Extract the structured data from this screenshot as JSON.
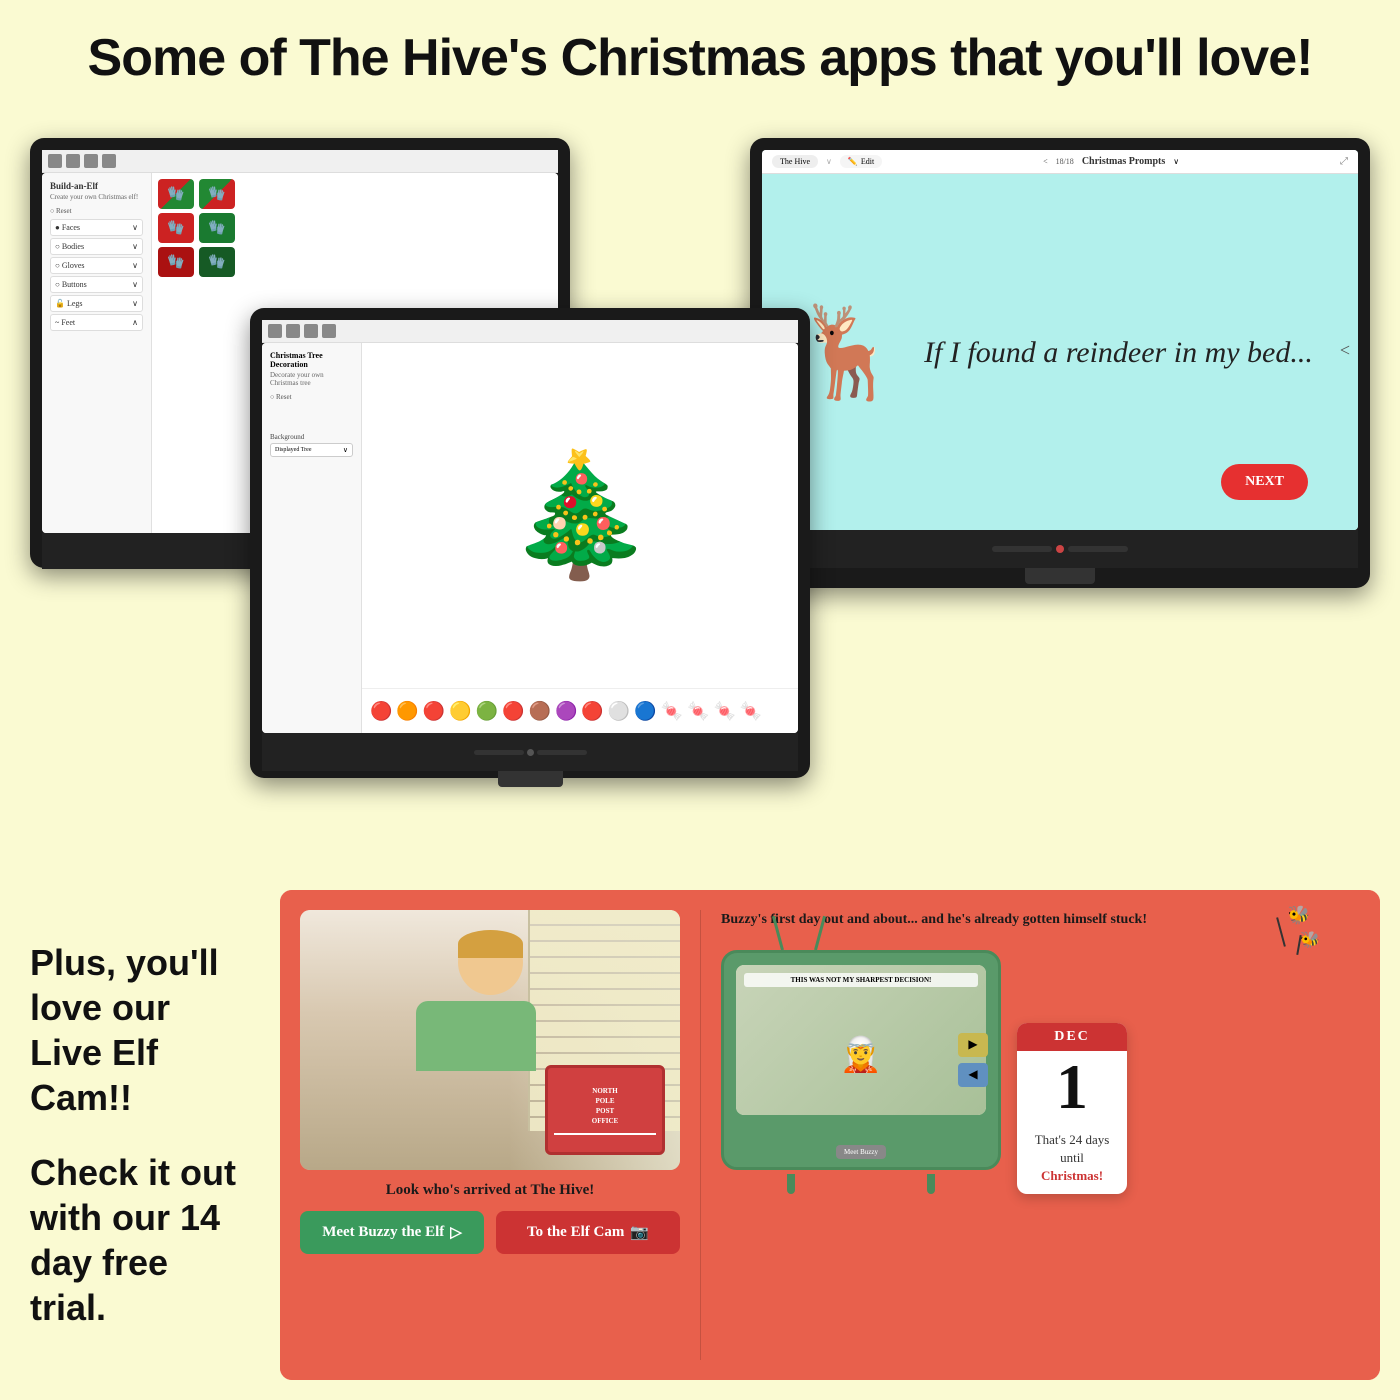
{
  "header": {
    "title": "Some of The Hive's Christmas apps that you'll love!"
  },
  "screens": {
    "build_elf": {
      "title": "Build-an-Elf",
      "subtitle": "Create your own Christmas elf!",
      "reset": "Reset",
      "categories": [
        "Faces",
        "Bodies",
        "Gloves",
        "Buttons",
        "Legs",
        "Feet"
      ]
    },
    "prompts": {
      "toolbar_label": "The Hive",
      "edit_label": "Edit",
      "nav": "18/18",
      "title": "Christmas Prompts",
      "prompt_text": "If I found a reindeer in my bed...",
      "next_btn": "NEXT"
    },
    "tree": {
      "title": "Christmas Tree Decoration",
      "subtitle": "Decorate your own Christmas tree",
      "reset": "Reset",
      "bg_label": "Background",
      "bg_value": "Displayed Tree"
    }
  },
  "bottom": {
    "left_text": "Plus, you'll love our Live Elf Cam!!\n\nCheck it out with our 14 day free trial.",
    "promo_left": {
      "video_caption": "Look who's arrived at The Hive!",
      "package_text": "NORTH POLE POST OFFICE",
      "btn_meet": "Meet Buzzy the Elf",
      "btn_cam": "To the Elf Cam"
    },
    "promo_right": {
      "buzzy_caption": "Buzzy's first day out and about... and he's already gotten himself stuck!",
      "tv_label": "THIS WAS NOT MY SHARPEST DECISION!",
      "tv_btn": "Meet Buzzy",
      "calendar": {
        "month": "DEC",
        "day": "1",
        "countdown_text": "That's 24 days until",
        "countdown_highlight": "Christmas!"
      }
    }
  }
}
